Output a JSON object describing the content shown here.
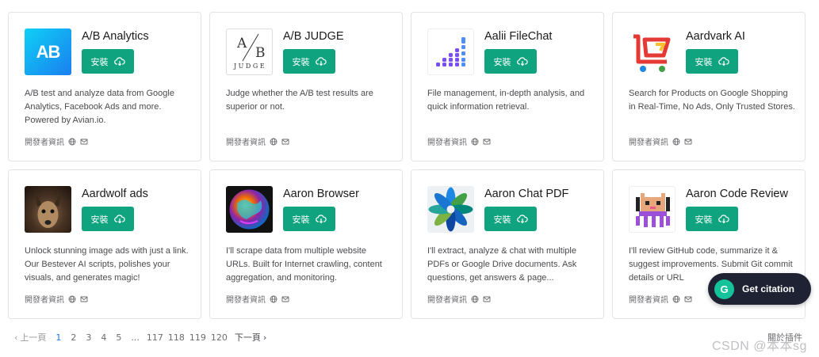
{
  "install_label": "安裝",
  "developer_info_label": "開發者資訊",
  "cards": [
    {
      "title": "A/B Analytics",
      "desc": "A/B test and analyze data from Google Analytics, Facebook Ads and more. Powered by Avian.io.",
      "logo": "ab-analytics-logo",
      "logo_text": "AB"
    },
    {
      "title": "A/B JUDGE",
      "desc": "Judge whether the A/B test results are superior or not.",
      "logo": "ab-judge-logo",
      "logo_text_top": "A",
      "logo_text_bottom": "B",
      "logo_text_word": "JUDGE"
    },
    {
      "title": "Aalii FileChat",
      "desc": "File management, in-depth analysis, and quick information retrieval.",
      "logo": "aalii-filechat-logo"
    },
    {
      "title": "Aardvark AI",
      "desc": "Search for Products on Google Shopping in Real-Time, No Ads, Only Trusted Stores.",
      "logo": "aardvark-cart-logo"
    },
    {
      "title": "Aardwolf ads",
      "desc": "Unlock stunning image ads with just a link. Our Bestever AI scripts, polishes your visuals, and generates magic!",
      "logo": "aardwolf-photo-logo"
    },
    {
      "title": "Aaron Browser",
      "desc": "I'll scrape data from multiple website URLs. Built for Internet crawling, content aggregation, and monitoring.",
      "logo": "aaron-browser-globe-logo"
    },
    {
      "title": "Aaron Chat PDF",
      "desc": "I'll extract, analyze & chat with multiple PDFs or Google Drive documents. Ask questions, get answers & page...",
      "logo": "aaron-chat-pdf-logo"
    },
    {
      "title": "Aaron Code Review",
      "desc": "I'll review GitHub code, summarize it & suggest improvements. Submit Git commit details or URL",
      "logo": "aaron-code-review-pixel-logo"
    }
  ],
  "pagination": {
    "prev_label": "上一頁",
    "pages": [
      "1",
      "2",
      "3",
      "4",
      "5",
      "...",
      "117",
      "118",
      "119",
      "120"
    ],
    "active_page": "1",
    "next_label": "下一頁"
  },
  "about_label": "關於插件",
  "citation_label": "Get citation",
  "citation_logo_letter": "G",
  "watermark": "CSDN @本本sg",
  "colors": {
    "install_button": "#10a37f",
    "active_page": "#1a73e8",
    "citation_bg": "#1f2233",
    "grammarly_green": "#15c39a"
  }
}
